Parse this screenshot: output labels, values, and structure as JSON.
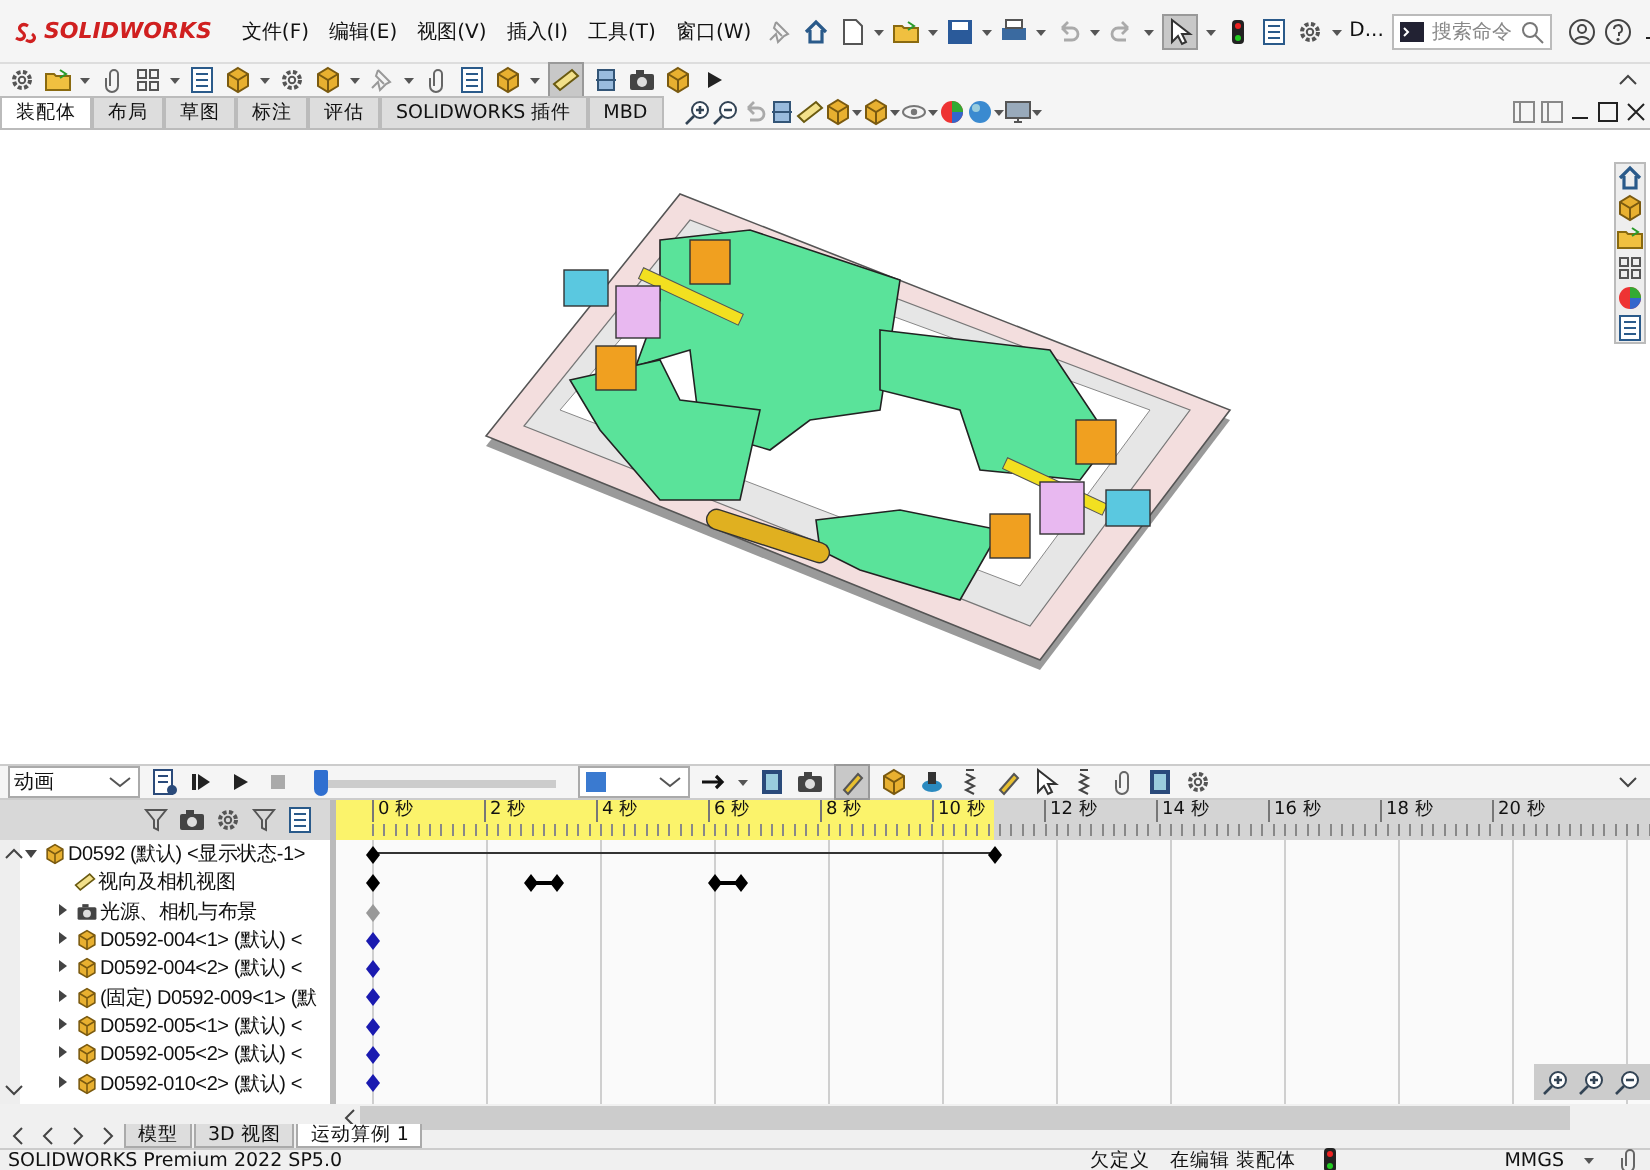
{
  "app": {
    "logo": "SOLIDWORKS"
  },
  "menu": [
    "文件(F)",
    "编辑(E)",
    "视图(V)",
    "插入(I)",
    "工具(T)",
    "窗口(W)"
  ],
  "quick_access": {
    "overflow_label": "D..."
  },
  "search": {
    "placeholder": "搜索命令"
  },
  "tabs": [
    {
      "label": "装配体",
      "selected": true
    },
    {
      "label": "布局",
      "selected": false
    },
    {
      "label": "草图",
      "selected": false
    },
    {
      "label": "标注",
      "selected": false
    },
    {
      "label": "评估",
      "selected": false
    },
    {
      "label": "SOLIDWORKS 插件",
      "selected": false
    },
    {
      "label": "MBD",
      "selected": false
    }
  ],
  "motion_study": {
    "study_type": {
      "value": "动画"
    },
    "playhead": {
      "level": 0
    }
  },
  "ruler": {
    "labels": [
      "0 秒",
      "2 秒",
      "4 秒",
      "6 秒",
      "8 秒",
      "10 秒",
      "12 秒",
      "14 秒",
      "16 秒",
      "18 秒",
      "20 秒"
    ],
    "level": 0.5
  },
  "tree": [
    {
      "label": "D0592 (默认) <显示状态-1>",
      "kind": "assembly",
      "expanded": true,
      "color": "#000000",
      "children": [
        {
          "label": "视向及相机视图",
          "kind": "camera",
          "color": "#000000"
        },
        {
          "label": "光源、相机与布景",
          "kind": "folder",
          "expanded": false,
          "color": "#999999"
        },
        {
          "label": "D0592-004<1> (默认) <",
          "kind": "part",
          "expanded": false,
          "color": "#1a1ab0"
        },
        {
          "label": "D0592-004<2> (默认) <",
          "kind": "part",
          "expanded": false,
          "color": "#1a1ab0"
        },
        {
          "label": "(固定) D0592-009<1> (默",
          "kind": "part",
          "expanded": false,
          "color": "#1a1ab0"
        },
        {
          "label": "D0592-005<1> (默认) <",
          "kind": "part",
          "expanded": false,
          "color": "#1a1ab0"
        },
        {
          "label": "D0592-005<2> (默认) <",
          "kind": "part",
          "expanded": false,
          "color": "#1a1ab0"
        },
        {
          "label": "D0592-010<2> (默认) <",
          "kind": "part",
          "expanded": false,
          "color": "#1a1ab0"
        }
      ]
    }
  ],
  "bottom_tabs": [
    {
      "label": "模型",
      "selected": false
    },
    {
      "label": "3D 视图",
      "selected": false
    },
    {
      "label": "运动算例 1",
      "selected": true
    }
  ],
  "status_bar": {
    "product": "SOLIDWORKS Premium 2022 SP5.0",
    "definition": "欠定义",
    "mode": "在编辑 装配体",
    "units": "MMGS"
  }
}
